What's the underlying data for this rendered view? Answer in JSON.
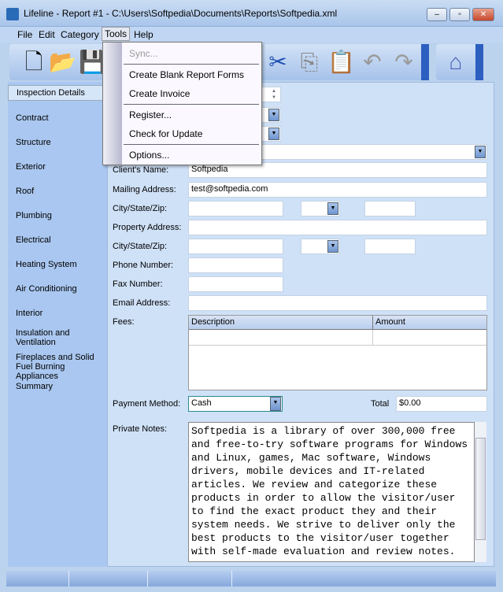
{
  "window": {
    "title": "Lifeline - Report #1 - C:\\Users\\Softpedia\\Documents\\Reports\\Softpedia.xml",
    "min": "–",
    "max": "▫",
    "close": "✕"
  },
  "menu": [
    "File",
    "Edit",
    "Category",
    "Tools",
    "Help"
  ],
  "tools_menu": [
    "Sync...",
    "Create Blank Report Forms",
    "Create Invoice",
    "Register...",
    "Check for Update",
    "Options..."
  ],
  "sidebar": [
    "Inspection Details",
    "Contract",
    "Structure",
    "Exterior",
    "Roof",
    "Plumbing",
    "Electrical",
    "Heating System",
    "Air Conditioning",
    "Interior",
    "Insulation and Ventilation",
    "Fireplaces and Solid Fuel Burning Appliances",
    "Summary"
  ],
  "form": {
    "client_name_label": "Client's Name:",
    "client_name": "Softpedia",
    "mailing_label": "Mailing Address:",
    "mailing": "test@softpedia.com",
    "city_label": "City/State/Zip:",
    "property_label": "Property Address:",
    "city2_label": "City/State/Zip:",
    "phone_label": "Phone Number:",
    "fax_label": "Fax Number:",
    "email_label": "Email Address:",
    "fees_label": "Fees:",
    "fees_cols": [
      "Description",
      "Amount"
    ],
    "payment_label": "Payment Method:",
    "payment": "Cash",
    "total_label": "Total",
    "total": "$0.00",
    "notes_label": "Private Notes:",
    "notes": "Softpedia is a library of over 300,000 free and free-to-try software programs for Windows and Linux, games, Mac software, Windows drivers, mobile devices and IT-related articles. We review and categorize these products in order to allow the visitor/user to find the exact product they and their system needs. We strive to deliver only the best products to the visitor/user together with self-made evaluation and review notes."
  }
}
